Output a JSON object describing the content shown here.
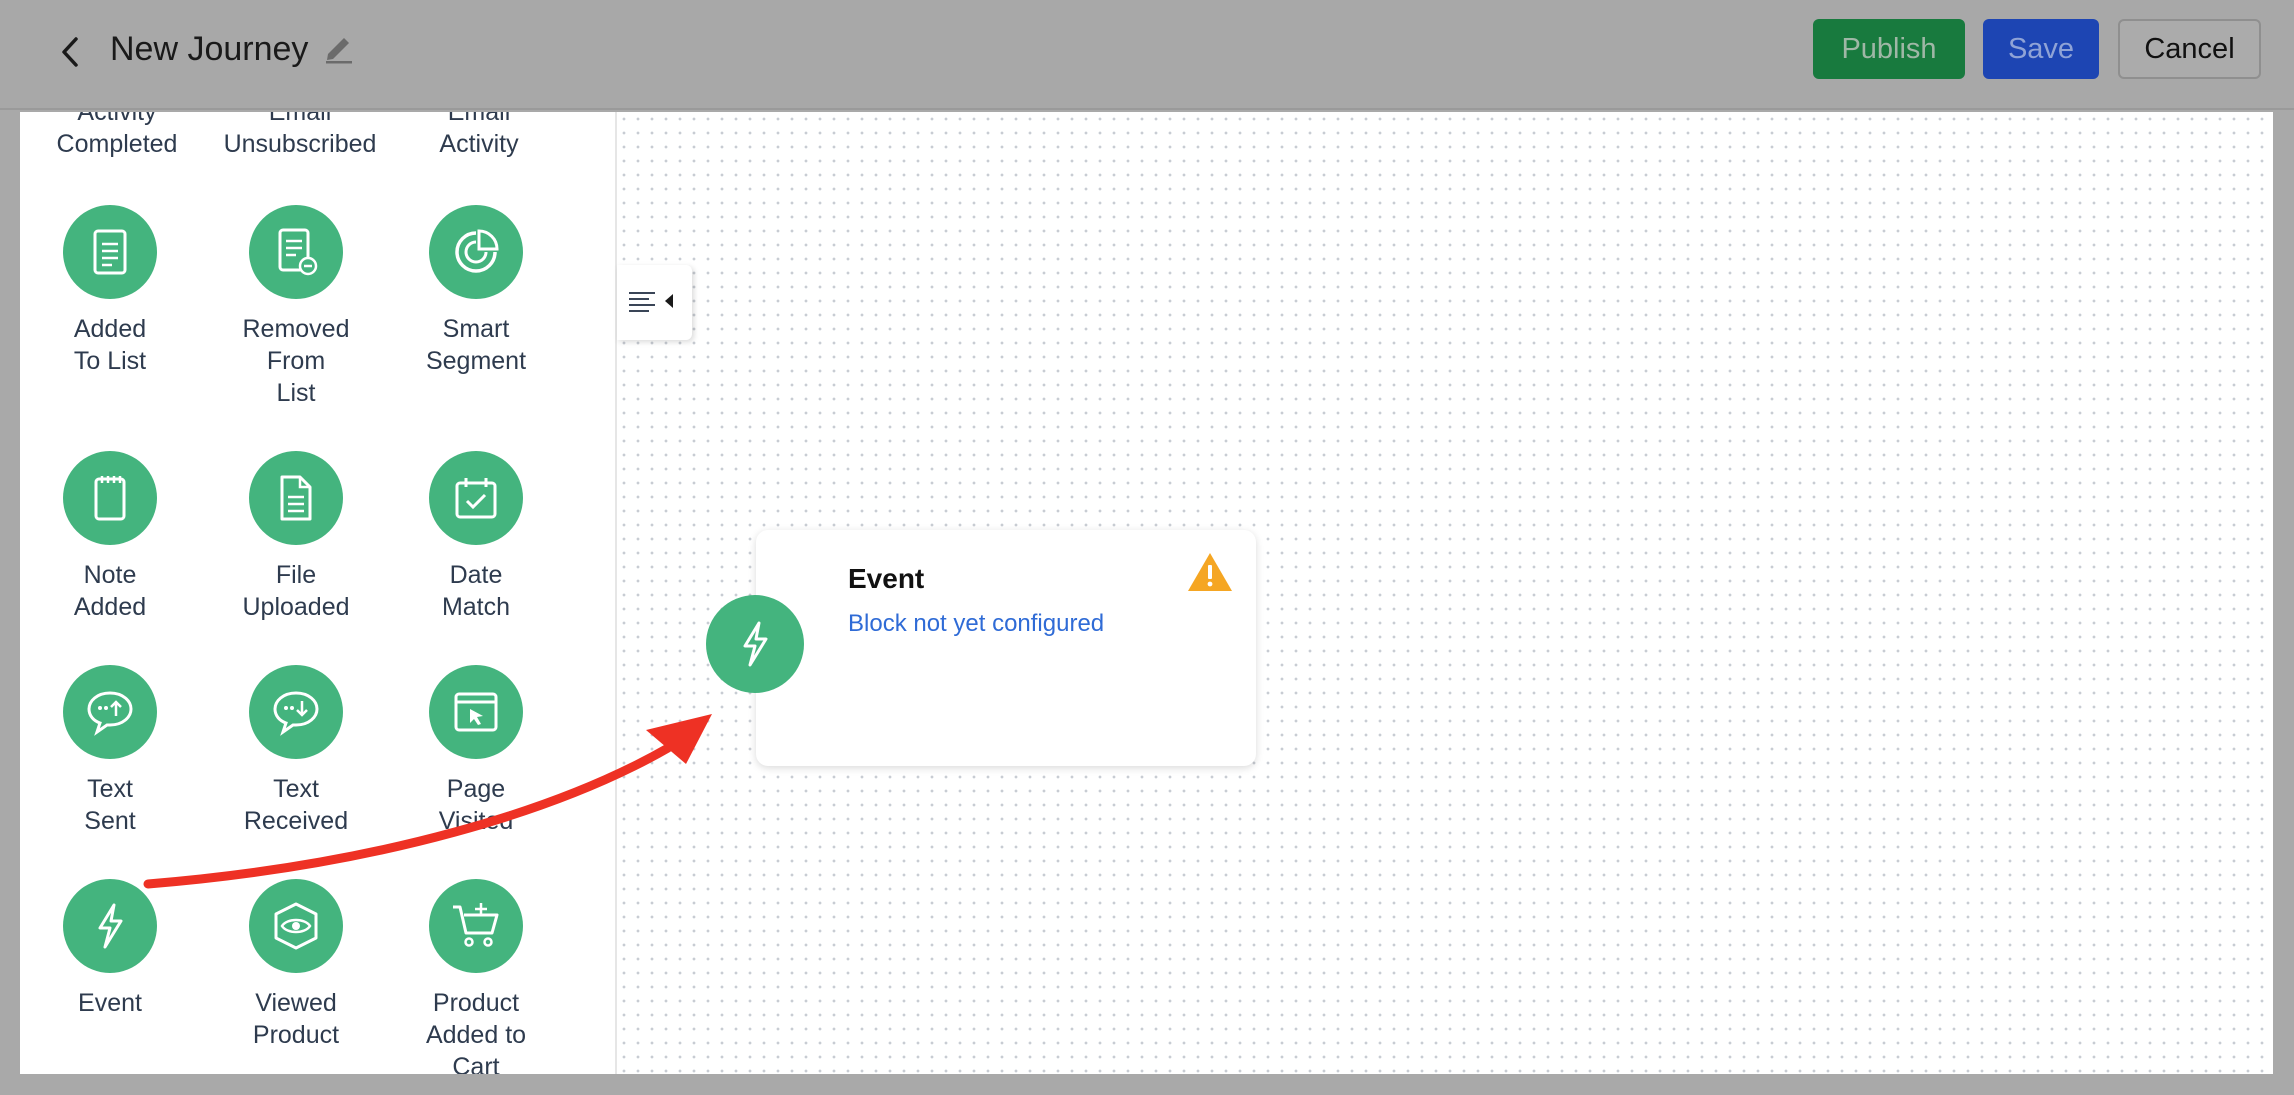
{
  "header": {
    "title": "New Journey",
    "publish_label": "Publish",
    "save_label": "Save",
    "cancel_label": "Cancel"
  },
  "sidebar": {
    "partial_top_labels": [
      "Activity\nCompleted",
      "Email\nUnsubscribed",
      "Email\nActivity"
    ],
    "triggers": [
      {
        "label": "Added\nTo List",
        "icon": "list-icon"
      },
      {
        "label": "Removed\nFrom\nList",
        "icon": "list-remove-icon"
      },
      {
        "label": "Smart\nSegment",
        "icon": "segment-icon"
      },
      {
        "label": "Note\nAdded",
        "icon": "note-icon"
      },
      {
        "label": "File\nUploaded",
        "icon": "file-icon"
      },
      {
        "label": "Date\nMatch",
        "icon": "calendar-check-icon"
      },
      {
        "label": "Text\nSent",
        "icon": "chat-sent-icon"
      },
      {
        "label": "Text\nReceived",
        "icon": "chat-received-icon"
      },
      {
        "label": "Page\nVisited",
        "icon": "browser-click-icon"
      },
      {
        "label": "Event",
        "icon": "lightning-icon"
      },
      {
        "label": "Viewed\nProduct",
        "icon": "eye-box-icon"
      },
      {
        "label": "Product\nAdded to\nCart",
        "icon": "cart-add-icon"
      }
    ]
  },
  "canvas": {
    "card": {
      "title": "Event",
      "subtitle": "Block not yet configured",
      "icon": "lightning-icon",
      "warning_icon": "warning-icon"
    }
  },
  "colors": {
    "accent_green": "#44b47e",
    "publish_green": "#187a3e",
    "save_blue": "#1d45b3",
    "link_blue": "#2f6bd6",
    "warning_orange": "#f5a623",
    "arrow_red": "#ee3124"
  }
}
